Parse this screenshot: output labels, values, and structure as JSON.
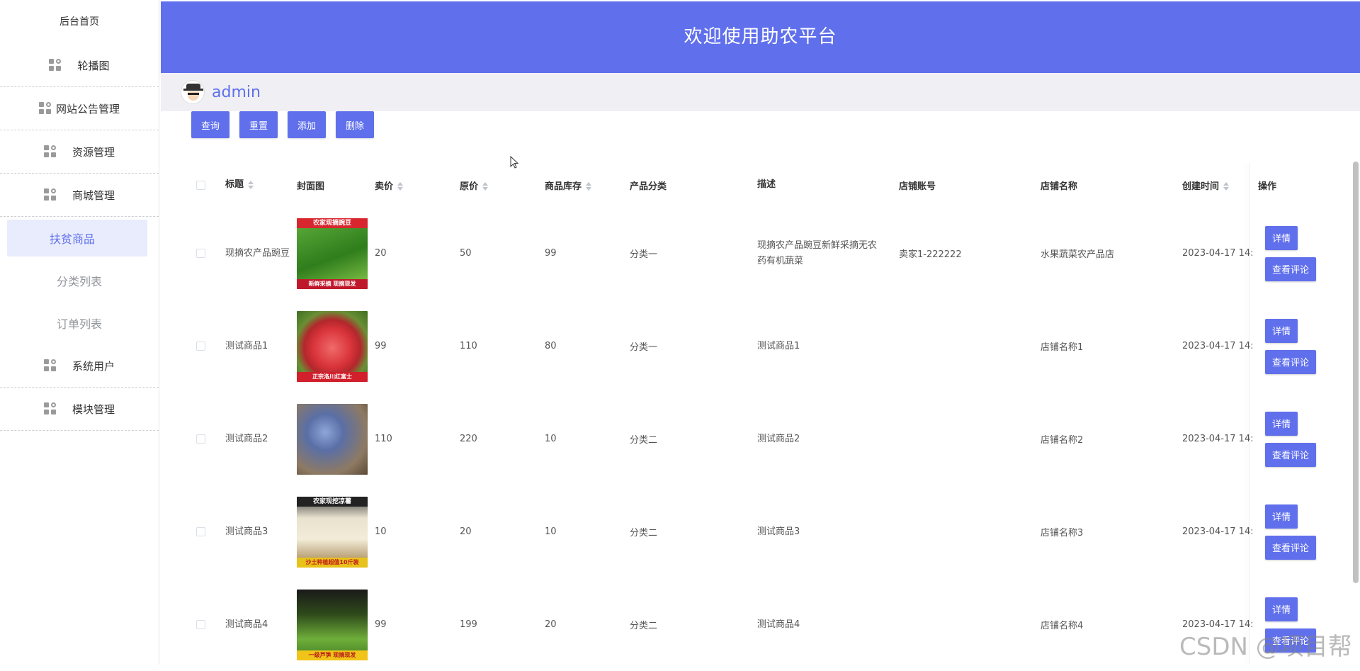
{
  "sidebar": {
    "home": "后台首页",
    "groups": [
      {
        "label": "轮播图"
      },
      {
        "label": "网站公告管理"
      },
      {
        "label": "资源管理"
      },
      {
        "label": "商城管理"
      }
    ],
    "sub": [
      {
        "label": "扶贫商品"
      },
      {
        "label": "分类列表"
      },
      {
        "label": "订单列表"
      }
    ],
    "groups2": [
      {
        "label": "系统用户"
      },
      {
        "label": "模块管理"
      }
    ]
  },
  "header": {
    "title": "欢迎使用助农平台"
  },
  "user": {
    "name": "admin"
  },
  "toolbar": {
    "query": "查询",
    "reset": "重置",
    "add": "添加",
    "delete": "删除"
  },
  "columns": {
    "title": "标题",
    "cover": "封面图",
    "price": "卖价",
    "orig": "原价",
    "stock": "商品库存",
    "category": "产品分类",
    "desc": "描述",
    "account": "店铺账号",
    "shop": "店铺名称",
    "created": "创建时间",
    "op": "操作"
  },
  "rows": [
    {
      "title": "现摘农产品豌豆",
      "cover_text_top": "农家现摘豌豆",
      "cover_text_bot": "新鲜采摘 现摘现发",
      "price": "20",
      "orig": "50",
      "stock": "99",
      "category": "分类一",
      "desc": "现摘农产品豌豆新鲜采摘无农药有机蔬菜",
      "account": "卖家1-222222",
      "shop": "水果蔬菜农产品店",
      "created": "2023-04-17 14:"
    },
    {
      "title": "测试商品1",
      "cover_text_top": "",
      "cover_text_bot": "正宗洛川红富士",
      "price": "99",
      "orig": "110",
      "stock": "80",
      "category": "分类一",
      "desc": "测试商品1",
      "account": "",
      "shop": "店铺名称1",
      "created": "2023-04-17 14:"
    },
    {
      "title": "测试商品2",
      "cover_text_top": "",
      "cover_text_bot": "",
      "price": "110",
      "orig": "220",
      "stock": "10",
      "category": "分类二",
      "desc": "测试商品2",
      "account": "",
      "shop": "店铺名称2",
      "created": "2023-04-17 14:"
    },
    {
      "title": "测试商品3",
      "cover_text_top": "农家现挖凉薯",
      "cover_text_bot": "沙土种植超值10斤装",
      "price": "10",
      "orig": "20",
      "stock": "10",
      "category": "分类二",
      "desc": "测试商品3",
      "account": "",
      "shop": "店铺名称3",
      "created": "2023-04-17 14:"
    },
    {
      "title": "测试商品4",
      "cover_text_top": "",
      "cover_text_bot": "一级芦笋 现摘现发",
      "price": "99",
      "orig": "199",
      "stock": "20",
      "category": "分类二",
      "desc": "测试商品4",
      "account": "",
      "shop": "店铺名称4",
      "created": "2023-04-17 14:"
    }
  ],
  "row_actions": {
    "detail": "详情",
    "comments": "查看评论"
  },
  "watermark": "CSDN @项目帮",
  "colors": {
    "accent": "#6070ec",
    "active_bg": "#e8ecfd"
  }
}
